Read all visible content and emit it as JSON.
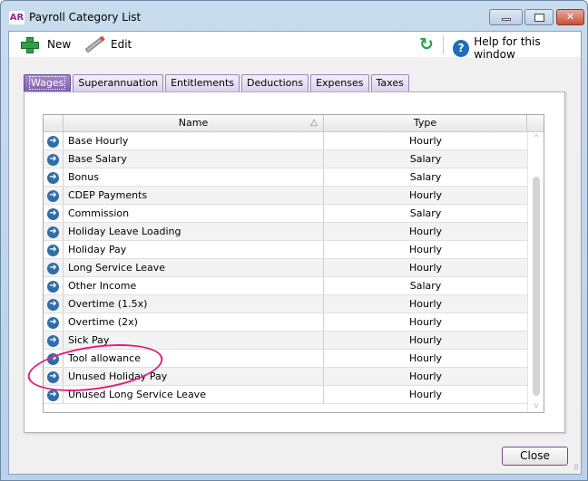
{
  "window": {
    "app_badge": "AR",
    "title": "Payroll Category List",
    "minimize": "",
    "maximize": "",
    "close_glyph": "✕"
  },
  "toolbar": {
    "new_label": "New",
    "edit_label": "Edit",
    "refresh_glyph": "↻",
    "help_label": "Help for this window",
    "help_glyph": "?"
  },
  "tabs": [
    {
      "label": "Wages",
      "active": true
    },
    {
      "label": "Superannuation"
    },
    {
      "label": "Entitlements"
    },
    {
      "label": "Deductions"
    },
    {
      "label": "Expenses"
    },
    {
      "label": "Taxes"
    }
  ],
  "grid": {
    "columns": {
      "name": "Name",
      "type": "Type",
      "sort_glyph": "△"
    },
    "rows": [
      {
        "name": "Base Hourly",
        "type": "Hourly"
      },
      {
        "name": "Base Salary",
        "type": "Salary"
      },
      {
        "name": "Bonus",
        "type": "Salary"
      },
      {
        "name": "CDEP Payments",
        "type": "Hourly"
      },
      {
        "name": "Commission",
        "type": "Salary"
      },
      {
        "name": "Holiday Leave Loading",
        "type": "Hourly"
      },
      {
        "name": "Holiday Pay",
        "type": "Hourly"
      },
      {
        "name": "Long Service Leave",
        "type": "Hourly"
      },
      {
        "name": "Other Income",
        "type": "Salary"
      },
      {
        "name": "Overtime (1.5x)",
        "type": "Hourly"
      },
      {
        "name": "Overtime (2x)",
        "type": "Hourly"
      },
      {
        "name": "Sick Pay",
        "type": "Hourly"
      },
      {
        "name": "Tool allowance",
        "type": "Hourly"
      },
      {
        "name": "Unused Holiday Pay",
        "type": "Hourly"
      },
      {
        "name": "Unused Long Service Leave",
        "type": "Hourly"
      }
    ],
    "row_arrow_glyph": "➜",
    "scroll_up": "^",
    "scroll_down": "v"
  },
  "footer": {
    "close_label": "Close",
    "grip_glyph": "⠿"
  },
  "annotation": {
    "highlighted_row": "Unused Holiday Pay",
    "color": "#e0207a"
  }
}
